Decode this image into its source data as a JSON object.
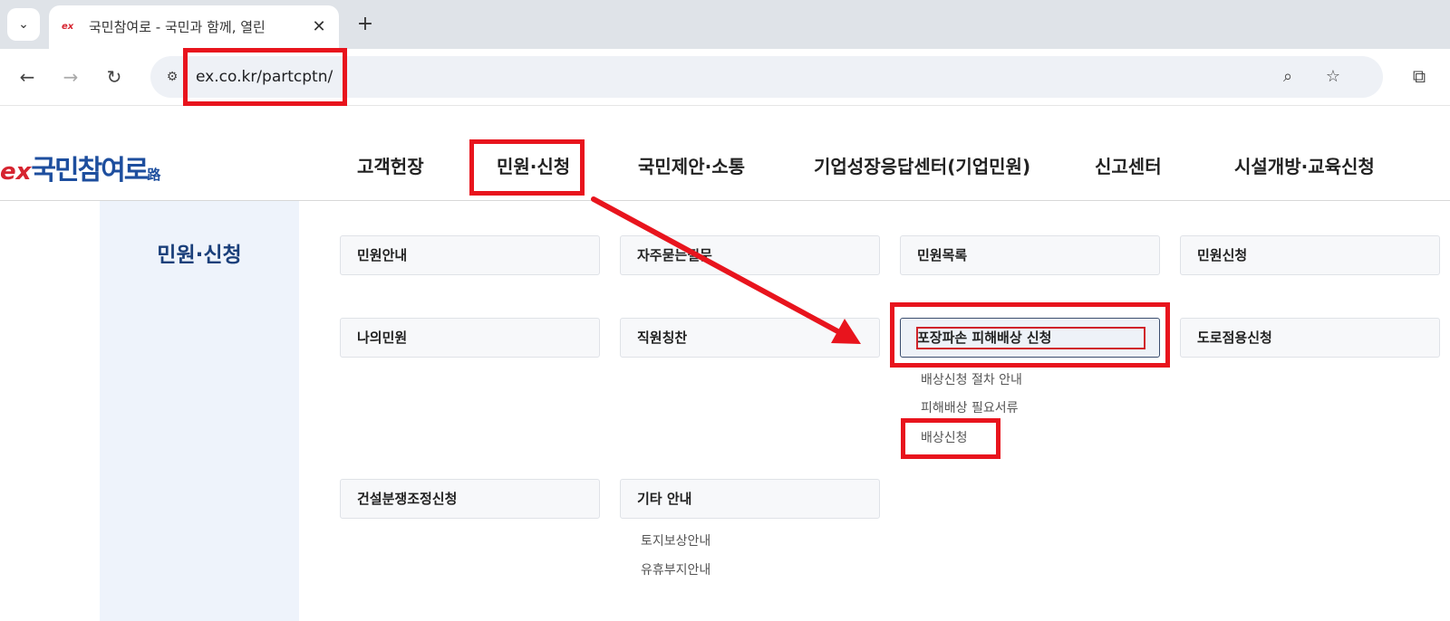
{
  "browser": {
    "tab_title": "국민참여로 - 국민과 함께, 열린",
    "favicon_text": "ex",
    "url": "ex.co.kr/partcptn/"
  },
  "site": {
    "logo": {
      "ex": "ex",
      "main": "국민참여로",
      "road": "路"
    },
    "gnb": [
      "고객헌장",
      "민원·신청",
      "국민제안·소통",
      "기업성장응답센터(기업민원)",
      "신고센터",
      "시설개방·교육신청"
    ],
    "sidebar_title": "민원·신청"
  },
  "menu": {
    "minwon_guide": "민원안내",
    "faq": "자주묻는질문",
    "minwon_list": "민원목록",
    "minwon_apply": "민원신청",
    "my_minwon": "나의민원",
    "staff_praise": "직원칭찬",
    "pavement_damage": "포장파손 피해배상 신청",
    "road_use": "도로점용신청",
    "pavement_sub": [
      "배상신청 절차 안내",
      "피해배상 필요서류",
      "배상신청"
    ],
    "construction": "건설분쟁조정신청",
    "other": "기타 안내",
    "other_sub": [
      "토지보상안내",
      "유휴부지안내"
    ]
  },
  "colors": {
    "highlight": "#e8141d",
    "brand_blue": "#1d4e9e",
    "brand_red": "#d62430"
  }
}
